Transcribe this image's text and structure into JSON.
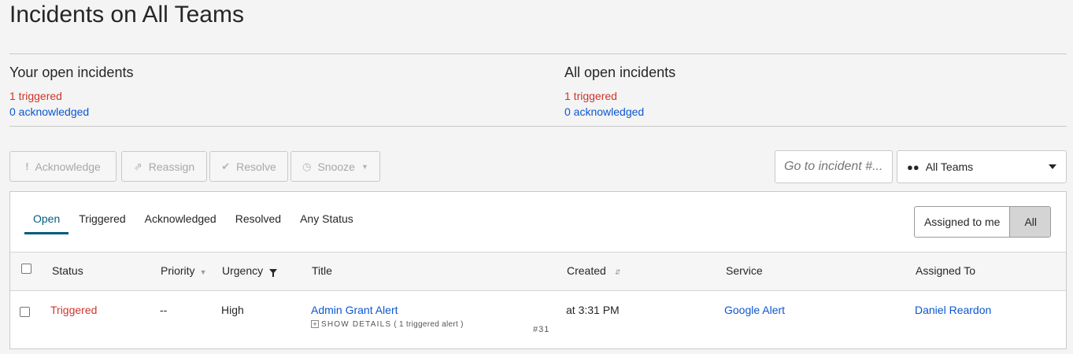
{
  "page": {
    "title": "Incidents on All Teams"
  },
  "summary": {
    "yours": {
      "title": "Your open incidents",
      "triggered": "1 triggered",
      "acknowledged": "0 acknowledged"
    },
    "all": {
      "title": "All open incidents",
      "triggered": "1 triggered",
      "acknowledged": "0 acknowledged"
    }
  },
  "toolbar": {
    "acknowledge": {
      "icon": "exclamation-icon",
      "label": "Acknowledge"
    },
    "reassign": {
      "icon": "share-icon",
      "label": "Reassign"
    },
    "resolve": {
      "icon": "check-icon",
      "label": "Resolve"
    },
    "snooze": {
      "icon": "clock-icon",
      "label": "Snooze"
    },
    "search_placeholder": "Go to incident #...",
    "team_select": {
      "icon": "people-icon",
      "value": "All Teams"
    }
  },
  "tabs": [
    {
      "label": "Open",
      "active": true
    },
    {
      "label": "Triggered"
    },
    {
      "label": "Acknowledged"
    },
    {
      "label": "Resolved"
    },
    {
      "label": "Any Status"
    }
  ],
  "assign_toggle": {
    "mine": "Assigned to me",
    "all": "All",
    "selected": "All"
  },
  "table": {
    "columns": [
      "Status",
      "Priority",
      "Urgency",
      "Title",
      "Created",
      "Service",
      "Assigned To"
    ],
    "rows": [
      {
        "status": "Triggered",
        "priority": "--",
        "urgency": "High",
        "title": "Admin Grant Alert",
        "details_label": "SHOW DETAILS",
        "alert_count": "( 1 triggered alert )",
        "number": "#31",
        "created": "at 3:31 PM",
        "service": "Google Alert",
        "assigned_to": "Daniel Reardon"
      }
    ]
  },
  "colors": {
    "triggered": "#d0342c",
    "link": "#0b57d0",
    "tab_active": "#045c7c"
  }
}
